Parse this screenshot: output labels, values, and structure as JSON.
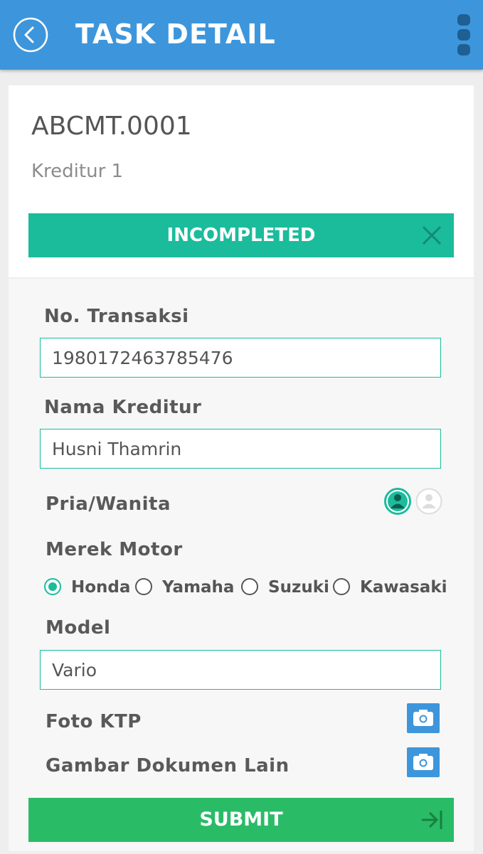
{
  "header": {
    "title": "TASK DETAIL",
    "back_icon": "back-arrow-icon",
    "menu_icon": "more-vertical-icon",
    "bg_color": "#3d96dc"
  },
  "task": {
    "code": "ABCMT.0001",
    "subtitle": "Kreditur 1",
    "status": "INCOMPLETED",
    "status_color": "#1abc9c",
    "status_icon": "close-icon"
  },
  "form": {
    "no_transaksi_label": "No. Transaksi",
    "no_transaksi_value": "1980172463785476",
    "nama_label": "Nama Kreditur",
    "nama_value": "Husni Thamrin",
    "gender_label": "Pria/Wanita",
    "gender_options": [
      {
        "icon": "male-user-icon",
        "selected": true
      },
      {
        "icon": "female-user-icon",
        "selected": false
      }
    ],
    "merek_label": "Merek Motor",
    "merek_options": [
      {
        "label": "Honda",
        "selected": true
      },
      {
        "label": "Yamaha",
        "selected": false
      },
      {
        "label": "Suzuki",
        "selected": false
      },
      {
        "label": "Kawasaki",
        "selected": false
      }
    ],
    "model_label": "Model",
    "model_value": "Vario",
    "foto_ktp_label": "Foto KTP",
    "gambar_label": "Gambar Dokumen Lain",
    "camera_icon": "camera-icon"
  },
  "submit": {
    "label": "SUBMIT",
    "icon": "arrow-right-to-bar-icon",
    "color": "#2abb67"
  }
}
